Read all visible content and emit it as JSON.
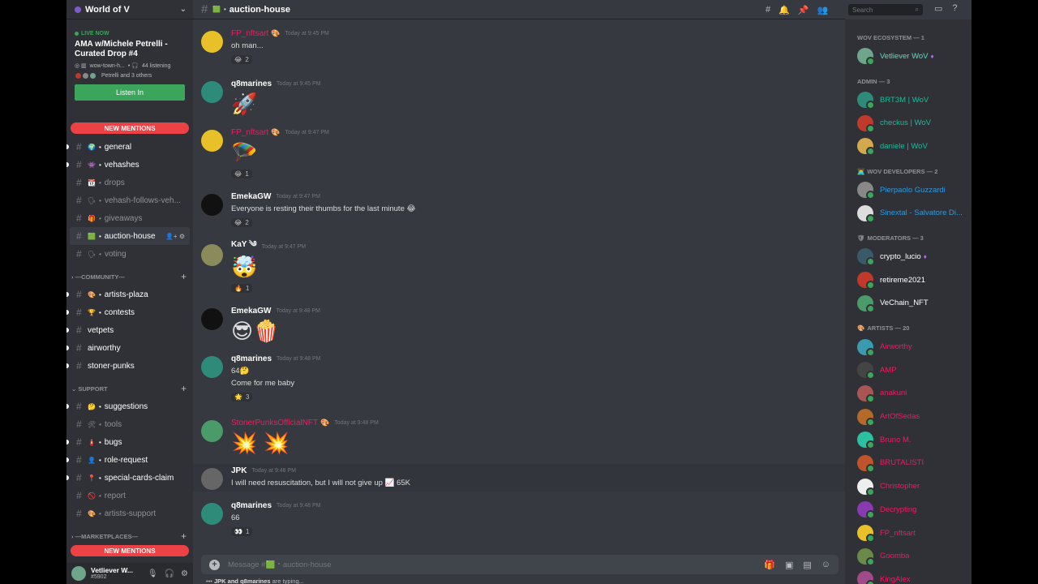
{
  "server": {
    "name": "World of V"
  },
  "stage": {
    "live_label": "LIVE NOW",
    "title": "AMA w/Michele Petrelli - Curated Drop #4",
    "channel": "wow-town-h...",
    "listening": "44 listening",
    "people": "Petrelli and 3 others",
    "listen_label": "Listen In"
  },
  "mentions_label": "NEW MENTIONS",
  "channels_top": [
    {
      "name": "general",
      "emoji": "🌍",
      "unread": true
    },
    {
      "name": "vehashes",
      "emoji": "👾",
      "unread": true
    },
    {
      "name": "drops",
      "emoji": "📆",
      "unread": false
    },
    {
      "name": "vehash-follows-veh...",
      "emoji": "🗣",
      "unread": false
    },
    {
      "name": "giveaways",
      "emoji": "🎁",
      "unread": false
    },
    {
      "name": "auction-house",
      "emoji": "🟩",
      "unread": false,
      "active": true
    },
    {
      "name": "voting",
      "emoji": "🗣",
      "unread": false
    }
  ],
  "category_community": "COMMUNITY",
  "channels_community": [
    {
      "name": "artists-plaza",
      "emoji": "🎨",
      "unread": true
    },
    {
      "name": "contests",
      "emoji": "🏆",
      "unread": true
    },
    {
      "name": "vetpets",
      "emoji": "",
      "unread": true
    },
    {
      "name": "airworthy",
      "emoji": "",
      "unread": true
    },
    {
      "name": "stoner-punks",
      "emoji": "",
      "unread": true
    }
  ],
  "category_support": "SUPPORT",
  "channels_support": [
    {
      "name": "suggestions",
      "emoji": "🤔",
      "unread": true
    },
    {
      "name": "tools",
      "emoji": "🛠",
      "unread": false
    },
    {
      "name": "bugs",
      "emoji": "🧯",
      "unread": true
    },
    {
      "name": "role-request",
      "emoji": "👤",
      "unread": true
    },
    {
      "name": "special-cards-claim",
      "emoji": "📍",
      "unread": true
    },
    {
      "name": "report",
      "emoji": "🚫",
      "unread": false
    },
    {
      "name": "artists-support",
      "emoji": "🎨",
      "unread": false
    }
  ],
  "category_marketplaces": "MARKETPLACES",
  "user": {
    "name": "Vetliever W...",
    "tag": "#5902"
  },
  "channel_header": {
    "name": "auction-house",
    "emoji": "🟩"
  },
  "search_placeholder": "Search",
  "messages": [
    {
      "user": "FP_nftsart",
      "pink": true,
      "badge": "🎨",
      "time": "Today at 9:45 PM",
      "text": "oh man...",
      "reaction": {
        "emoji": "😂",
        "count": "2"
      },
      "avatar_color": "#e8c02a"
    },
    {
      "user": "q8marines",
      "pink": false,
      "time": "Today at 9:45 PM",
      "big": "🚀",
      "avatar_color": "#2e8b7a"
    },
    {
      "user": "FP_nftsart",
      "pink": true,
      "badge": "🎨",
      "time": "Today at 9:47 PM",
      "big": "🪂",
      "reaction": {
        "emoji": "😂",
        "count": "1"
      },
      "avatar_color": "#e8c02a"
    },
    {
      "user": "EmekaGW",
      "pink": false,
      "time": "Today at 9:47 PM",
      "text": "Everyone is resting their thumbs for the last minute 😂",
      "reaction": {
        "emoji": "😂",
        "count": "2"
      },
      "avatar_color": "#111"
    },
    {
      "user": "KaY ༄",
      "pink": false,
      "time": "Today at 9:47 PM",
      "big": "🤯",
      "reaction": {
        "emoji": "🔥",
        "count": "1"
      },
      "avatar_color": "#8a8a5a"
    },
    {
      "user": "EmekaGW",
      "pink": false,
      "time": "Today at 9:48 PM",
      "big": "😎🍿",
      "avatar_color": "#111"
    },
    {
      "user": "q8marines",
      "pink": false,
      "time": "Today at 9:48 PM",
      "text": "64🤔",
      "text2": "Come for me baby",
      "reaction": {
        "emoji": "🌟",
        "count": "3"
      },
      "avatar_color": "#2e8b7a"
    },
    {
      "user": "StonerPunksOfficialNFT",
      "pink": true,
      "badge": "🎨",
      "time": "Today at 9:48 PM",
      "big": "💥 💥",
      "avatar_color": "#4a9a6a"
    },
    {
      "user": "JPK",
      "pink": false,
      "time": "Today at 9:48 PM",
      "text": "I will need resuscitation, but I will not give up 📈 65K",
      "avatar_color": "#666"
    },
    {
      "user": "q8marines",
      "pink": false,
      "time": "Today at 9:48 PM",
      "text": "66",
      "reaction": {
        "emoji": "👀",
        "count": "1"
      },
      "avatar_color": "#2e8b7a"
    }
  ],
  "input_placeholder": "Message #🟩・auction-house",
  "typing": {
    "names": "JPK and q8marines",
    "suffix": " are typing..."
  },
  "member_groups": [
    {
      "title": "WOV ECOSYSTEM — 1",
      "icon": "",
      "members": [
        {
          "name": "Vetliever WoV",
          "color": "c-lightteal",
          "badge": "♦",
          "av": "#6fa58a"
        }
      ]
    },
    {
      "title": "ADMIN — 3",
      "icon": "",
      "members": [
        {
          "name": "BRT3M | WoV",
          "color": "c-teal",
          "av": "#2e8b7a"
        },
        {
          "name": "checkus | WoV",
          "color": "c-teal",
          "av": "#c0392b"
        },
        {
          "name": "daniele | WoV",
          "color": "c-teal",
          "av": "#d4a84c"
        }
      ]
    },
    {
      "title": "WOV DEVELOPERS — 2",
      "icon": "👨‍💻",
      "members": [
        {
          "name": "Pierpaolo Guzzardi",
          "color": "c-blue",
          "av": "#888"
        },
        {
          "name": "Sinextal - Salvatore Di...",
          "color": "c-blue",
          "av": "#ddd"
        }
      ]
    },
    {
      "title": "MODERATORS — 3",
      "icon": "🛡",
      "members": [
        {
          "name": "crypto_lucio",
          "color": "c-white",
          "badge": "♦",
          "av": "#3a5a6a"
        },
        {
          "name": "retireme2021",
          "color": "c-white",
          "av": "#c0392b"
        },
        {
          "name": "VeChain_NFT",
          "color": "c-white",
          "av": "#4a9a6a"
        }
      ]
    },
    {
      "title": "ARTISTS — 20",
      "icon": "🎨",
      "members": [
        {
          "name": "Airworthy",
          "color": "c-pink",
          "av": "#3a9ab0"
        },
        {
          "name": "AMP",
          "color": "c-pink",
          "av": "#444"
        },
        {
          "name": "anakuni",
          "color": "c-pink",
          "av": "#a55"
        },
        {
          "name": "ArtOfSedas",
          "color": "c-pink",
          "av": "#b66a2a"
        },
        {
          "name": "Bruno M.",
          "color": "c-pink",
          "av": "#2ac0a0"
        },
        {
          "name": "BRUTALISTI",
          "color": "c-pink",
          "av": "#c0532a"
        },
        {
          "name": "Christopher",
          "color": "c-pink",
          "av": "#eee"
        },
        {
          "name": "Decrypting",
          "color": "c-pink",
          "av": "#8a3ab0"
        },
        {
          "name": "FP_nftsart",
          "color": "c-pink",
          "av": "#e8c02a"
        },
        {
          "name": "Goomba",
          "color": "c-pink",
          "av": "#6a8a4a"
        },
        {
          "name": "KingAlex",
          "color": "c-pink",
          "av": "#a04a8a"
        }
      ]
    }
  ]
}
